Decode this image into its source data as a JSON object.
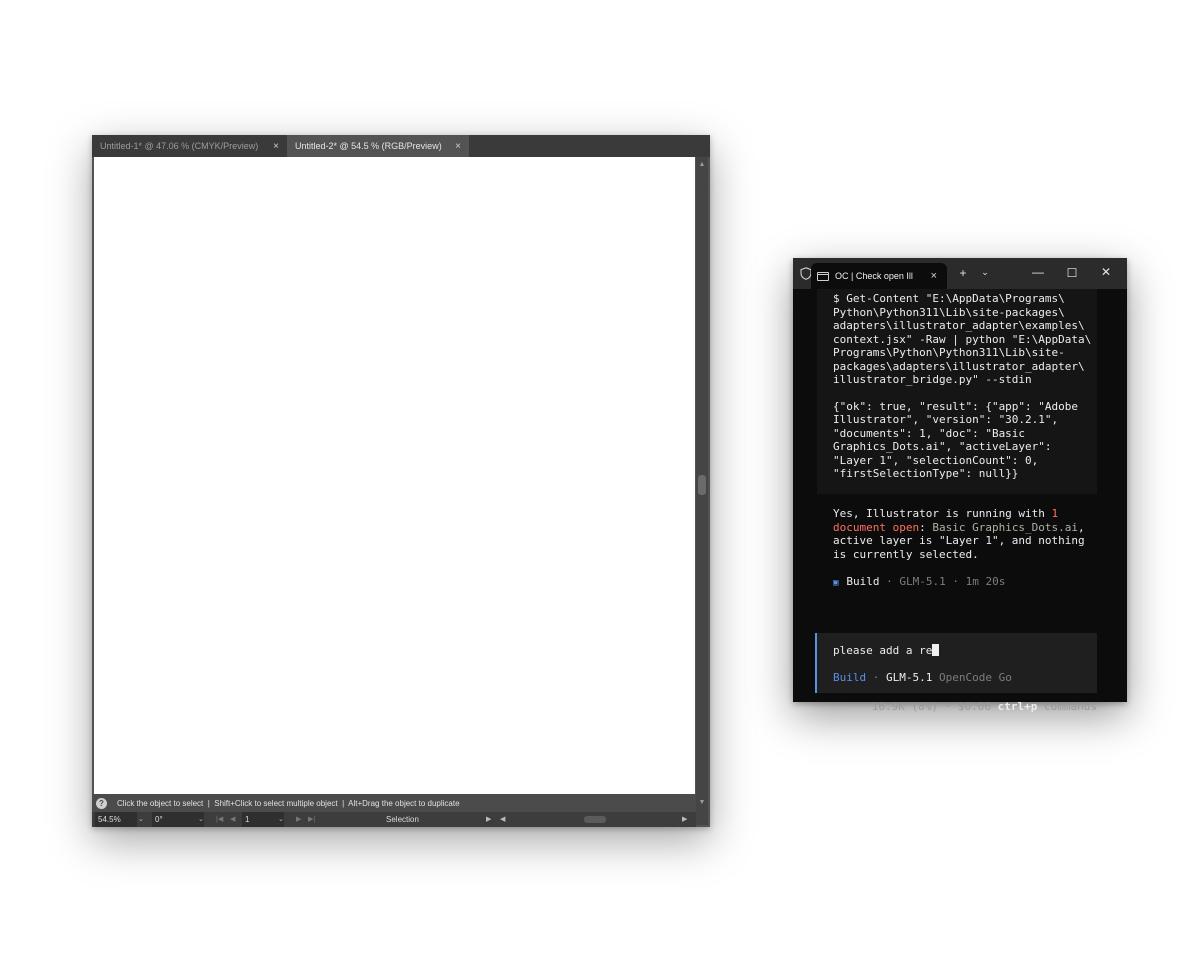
{
  "illustrator": {
    "tabs": [
      {
        "label": "Untitled-1* @ 47.06 % (CMYK/Preview)",
        "close": "×",
        "active": false
      },
      {
        "label": "Untitled-2* @ 54.5 % (RGB/Preview)",
        "close": "×",
        "active": true
      }
    ],
    "status_hint": "Click the object to select  |  Shift+Click to select multiple object  |  Alt+Drag the object to duplicate",
    "help_icon": "?",
    "bottom_bar": {
      "zoom": "54.5%",
      "rotation": "0°",
      "artboard": "1",
      "tool": "Selection"
    }
  },
  "terminal": {
    "tab_title": "OC | Check open Ill",
    "tab_close": "×",
    "new_tab": "+",
    "dropdown": "⌄",
    "minimize": "—",
    "maximize": "☐",
    "close": "✕",
    "command": "$ Get-Content \"E:\\AppData\\Programs\\\nPython\\Python311\\Lib\\site-packages\\\nadapters\\illustrator_adapter\\examples\\\ncontext.jsx\" -Raw | python \"E:\\AppData\\\nPrograms\\Python\\Python311\\Lib\\site-\npackages\\adapters\\illustrator_adapter\\\nillustrator_bridge.py\" --stdin",
    "result": "{\"ok\": true, \"result\": {\"app\": \"Adobe\nIllustrator\", \"version\": \"30.2.1\",\n\"documents\": 1, \"doc\": \"Basic\nGraphics_Dots.ai\", \"activeLayer\":\n\"Layer 1\", \"selectionCount\": 0,\n\"firstSelectionType\": null}}",
    "answer": {
      "p1": "Yes, Illustrator is running with ",
      "p2": "1",
      "p3": "\n",
      "p4": "document open",
      "p5": ": ",
      "p6": "Basic Graphics_Dots.ai",
      "p7": ",\nactive layer is \"Layer 1\", and nothing\nis currently selected."
    },
    "build_status": {
      "icon": "▣",
      "mode": "Build",
      "sep1": " · ",
      "model": "GLM-5.1",
      "sep2": " · ",
      "duration": "1m 20s"
    },
    "prompt": {
      "input": "please add a re",
      "agent": "Build",
      "sep": " · ",
      "model": "GLM-5.1",
      "provider": " OpenCode Go"
    },
    "footer": {
      "tokens": "16.9K (8%) · $0.06 ",
      "shortcut": "ctrl+p",
      "label": " commands"
    },
    "accent_color": "#5b8fe8"
  }
}
